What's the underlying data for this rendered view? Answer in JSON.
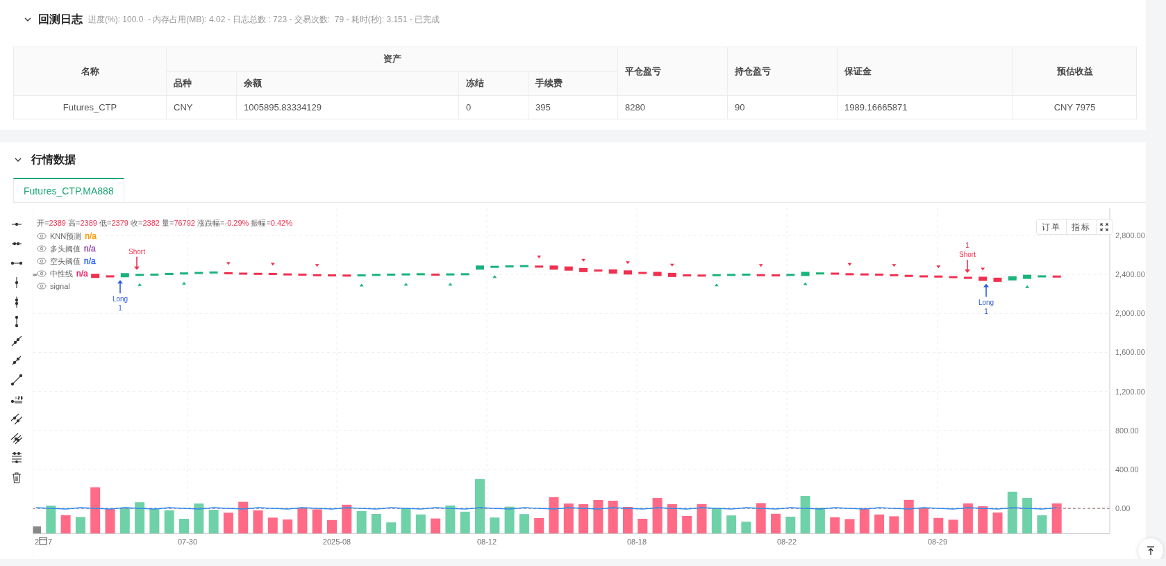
{
  "log": {
    "title": "回测日志",
    "expanded": true,
    "summary": "进度(%): 100.0  - 内存占用(MB): 4.02 - 日志总数 : 723 - 交易次数:  79 - 耗时(秒): 3.151 - 已完成"
  },
  "table": {
    "header_rows": [
      [
        {
          "text": "名称",
          "rowspan": 2
        },
        {
          "text": "资产",
          "colspan": 4
        },
        {
          "text": "平仓盈亏",
          "rowspan": 2
        },
        {
          "text": "持仓盈亏",
          "rowspan": 2
        },
        {
          "text": "保证金",
          "rowspan": 2
        },
        {
          "text": "预估收益",
          "rowspan": 2
        }
      ],
      [
        {
          "text": "品种"
        },
        {
          "text": "余额"
        },
        {
          "text": "冻结"
        },
        {
          "text": "手续费"
        }
      ]
    ],
    "rows": [
      [
        "Futures_CTP",
        "CNY",
        "1005895.83334129",
        "0",
        "395",
        "8280",
        "90",
        "1989.16665871",
        "CNY 7975"
      ]
    ]
  },
  "market": {
    "title": "行情数据",
    "expanded": true,
    "tabs": [
      {
        "label": "Futures_CTP.MA888",
        "selected": true
      }
    ],
    "ohlc": [
      {
        "label": "开=",
        "value": "2389"
      },
      {
        "label": "高=",
        "value": "2389"
      },
      {
        "label": "低=",
        "value": "2379"
      },
      {
        "label": "收=",
        "value": "2382"
      },
      {
        "label": "量=",
        "value": "76792"
      },
      {
        "label": "涨跌幅=",
        "value": "-0.29%"
      },
      {
        "label": "振幅=",
        "value": "0.42%"
      }
    ],
    "legend": [
      {
        "name": "KNN预测",
        "value": "n/a",
        "color": "#ff9800"
      },
      {
        "name": "多头阈值",
        "value": "n/a",
        "color": "#8e44ad"
      },
      {
        "name": "空头阈值",
        "value": "n/a",
        "color": "#2962ff"
      },
      {
        "name": "中性线",
        "value": "n/a",
        "color": "#e91e63"
      },
      {
        "name": "signal"
      }
    ],
    "buttons": [
      "订单",
      "指标"
    ],
    "chart": {
      "y_axis_labels": [
        "2,800.00",
        "2,400.00",
        "2,000.00",
        "1,600.00",
        "1,200.00",
        "800.00",
        "400.00",
        "0.00"
      ],
      "x_axis_labels": [
        "2",
        "7",
        "07-30",
        "2025-08",
        "08-12",
        "08-18",
        "08-22",
        "08-29"
      ],
      "trade_marks": [
        {
          "kind": "short",
          "label": "Short"
        },
        {
          "kind": "long",
          "label": "Long",
          "count": "1"
        },
        {
          "kind": "short",
          "label": "Short",
          "count": "1"
        },
        {
          "kind": "long",
          "label": "Long",
          "count": "1"
        }
      ]
    }
  }
}
